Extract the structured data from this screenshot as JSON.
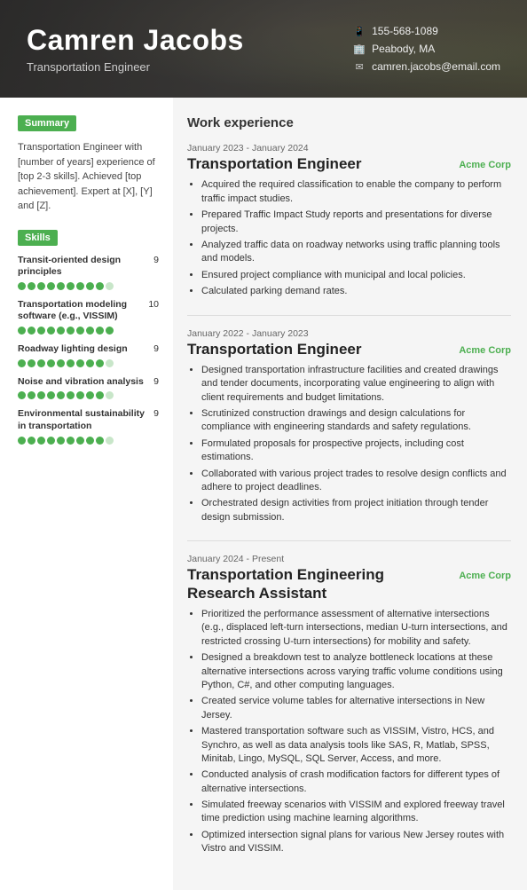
{
  "header": {
    "name": "Camren Jacobs",
    "title": "Transportation Engineer",
    "phone": "155-568-1089",
    "location": "Peabody, MA",
    "email": "camren.jacobs@email.com"
  },
  "summary": {
    "badge": "Summary",
    "text": "Transportation Engineer with [number of years] experience of [top 2-3 skills]. Achieved [top achievement]. Expert at [X], [Y] and [Z]."
  },
  "skills": {
    "badge": "Skills",
    "items": [
      {
        "name": "Transit-oriented design principles",
        "score": 9,
        "max": 10
      },
      {
        "name": "Transportation modeling software (e.g., VISSIM)",
        "score": 10,
        "max": 10
      },
      {
        "name": "Roadway lighting design",
        "score": 9,
        "max": 10
      },
      {
        "name": "Noise and vibration analysis",
        "score": 9,
        "max": 10
      },
      {
        "name": "Environmental sustainability in transportation",
        "score": 9,
        "max": 10
      }
    ]
  },
  "work_experience": {
    "section_title": "Work experience",
    "jobs": [
      {
        "date": "January 2023 - January 2024",
        "title": "Transportation Engineer",
        "company": "Acme Corp",
        "bullets": [
          "Acquired the required classification to enable the company to perform traffic impact studies.",
          "Prepared Traffic Impact Study reports and presentations for diverse projects.",
          "Analyzed traffic data on roadway networks using traffic planning tools and models.",
          "Ensured project compliance with municipal and local policies.",
          "Calculated parking demand rates."
        ]
      },
      {
        "date": "January 2022 - January 2023",
        "title": "Transportation Engineer",
        "company": "Acme Corp",
        "bullets": [
          "Designed transportation infrastructure facilities and created drawings and tender documents, incorporating value engineering to align with client requirements and budget limitations.",
          "Scrutinized construction drawings and design calculations for compliance with engineering standards and safety regulations.",
          "Formulated proposals for prospective projects, including cost estimations.",
          "Collaborated with various project trades to resolve design conflicts and adhere to project deadlines.",
          "Orchestrated design activities from project initiation through tender design submission."
        ]
      },
      {
        "date": "January 2024 - Present",
        "title": "Transportation Engineering\nResearch Assistant",
        "company": "Acme Corp",
        "bullets": [
          "Prioritized the performance assessment of alternative intersections (e.g., displaced left-turn intersections, median U-turn intersections, and restricted crossing U-turn intersections) for mobility and safety.",
          "Designed a breakdown test to analyze bottleneck locations at these alternative intersections across varying traffic volume conditions using Python, C#, and other computing languages.",
          "Created service volume tables for alternative intersections in New Jersey.",
          "Mastered transportation software such as VISSIM, Vistro, HCS, and Synchro, as well as data analysis tools like SAS, R, Matlab, SPSS, Minitab, Lingo, MySQL, SQL Server, Access, and more.",
          "Conducted analysis of crash modification factors for different types of alternative intersections.",
          "Simulated freeway scenarios with VISSIM and explored freeway travel time prediction using machine learning algorithms.",
          "Optimized intersection signal plans for various New Jersey routes with Vistro and VISSIM."
        ]
      }
    ]
  }
}
